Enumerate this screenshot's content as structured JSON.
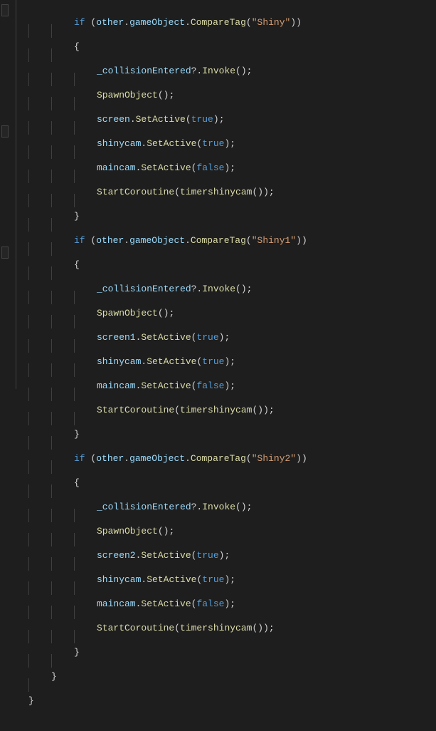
{
  "code": {
    "kw_if": "if",
    "other": "other",
    "gameObject": "gameObject",
    "CompareTag": "CompareTag",
    "tag_shiny": "\"Shiny\"",
    "tag_shiny1": "\"Shiny1\"",
    "tag_shiny2": "\"Shiny2\"",
    "collisionEntered": "_collisionEntered",
    "Invoke": "Invoke",
    "SpawnObject": "SpawnObject",
    "screen": "screen",
    "screen1": "screen1",
    "screen2": "screen2",
    "SetActive": "SetActive",
    "true": "true",
    "false": "false",
    "shinycam": "shinycam",
    "maincam": "maincam",
    "StartCoroutine": "StartCoroutine",
    "timershinycam": "timershinycam",
    "open_brace": "{",
    "close_brace": "}",
    "open_paren": "(",
    "close_paren": ")",
    "dot": ".",
    "semi": ";",
    "nullcond": "?.",
    "empty_parens": "()"
  }
}
